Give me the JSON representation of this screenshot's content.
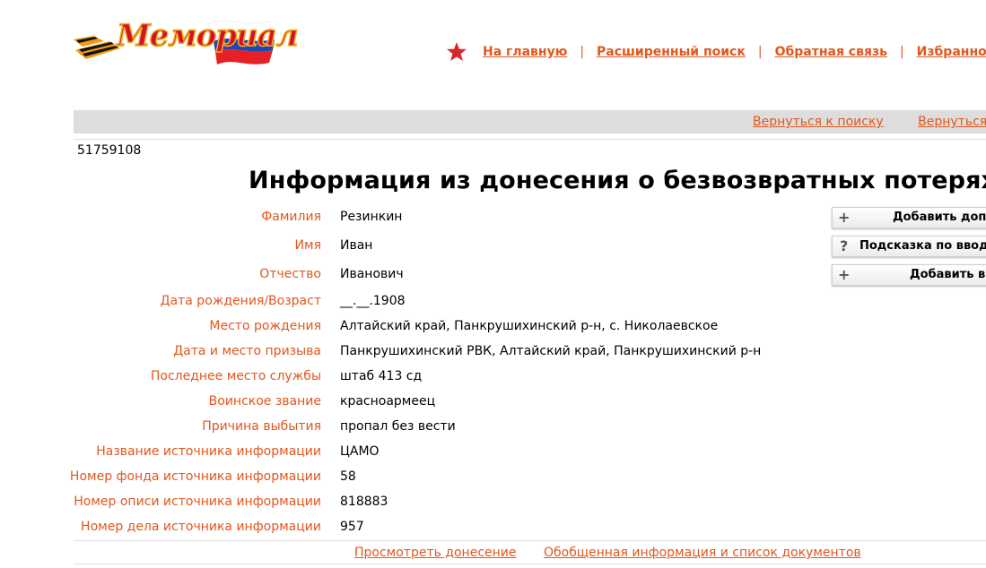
{
  "header": {
    "logo_text": "Мемориал",
    "nav": [
      {
        "label": "На главную"
      },
      {
        "label": "Расширенный поиск"
      },
      {
        "label": "Обратная связь"
      },
      {
        "label": "Избранное"
      }
    ],
    "separator": "|",
    "nav_trailing_separator": "|"
  },
  "backnav": {
    "back_to_search": "Вернуться к поиску",
    "back_truncated": "Вернуться к"
  },
  "record": {
    "id": "51759108",
    "title": "Информация из донесения о безвозвратных потерях",
    "fields": [
      {
        "label": "Фамилия",
        "value": "Резинкин"
      },
      {
        "label": "Имя",
        "value": "Иван"
      },
      {
        "label": "Отчество",
        "value": "Иванович"
      },
      {
        "label": "Дата рождения/Возраст",
        "value": "__.__.1908"
      },
      {
        "label": "Место рождения",
        "value": "Алтайский край, Панкрушихинский р-н, с. Николаевское"
      },
      {
        "label": "Дата и место призыва",
        "value": "Панкрушихинский РВК, Алтайский край, Панкрушихинский р-н"
      },
      {
        "label": "Последнее место службы",
        "value": "штаб 413 сд"
      },
      {
        "label": "Воинское звание",
        "value": "красноармеец"
      },
      {
        "label": "Причина выбытия",
        "value": "пропал без вести"
      },
      {
        "label": "Название источника информации",
        "value": "ЦАМО"
      },
      {
        "label": "Номер фонда источника информации",
        "value": "58"
      },
      {
        "label": "Номер описи источника информации",
        "value": "818883"
      },
      {
        "label": "Номер дела источника информации",
        "value": "957"
      }
    ]
  },
  "side_buttons": [
    {
      "icon": "+",
      "label": "Добавить доп."
    },
    {
      "icon": "?",
      "label": "Подсказка по вводу"
    },
    {
      "icon": "+",
      "label": "Добавить в"
    }
  ],
  "footer": {
    "view_report": "Просмотреть донесение",
    "summary": "Обобщенная информация и список документов"
  },
  "colors": {
    "accent": "#e2571e",
    "bar": "#dddddd",
    "star": "#d8262b"
  }
}
